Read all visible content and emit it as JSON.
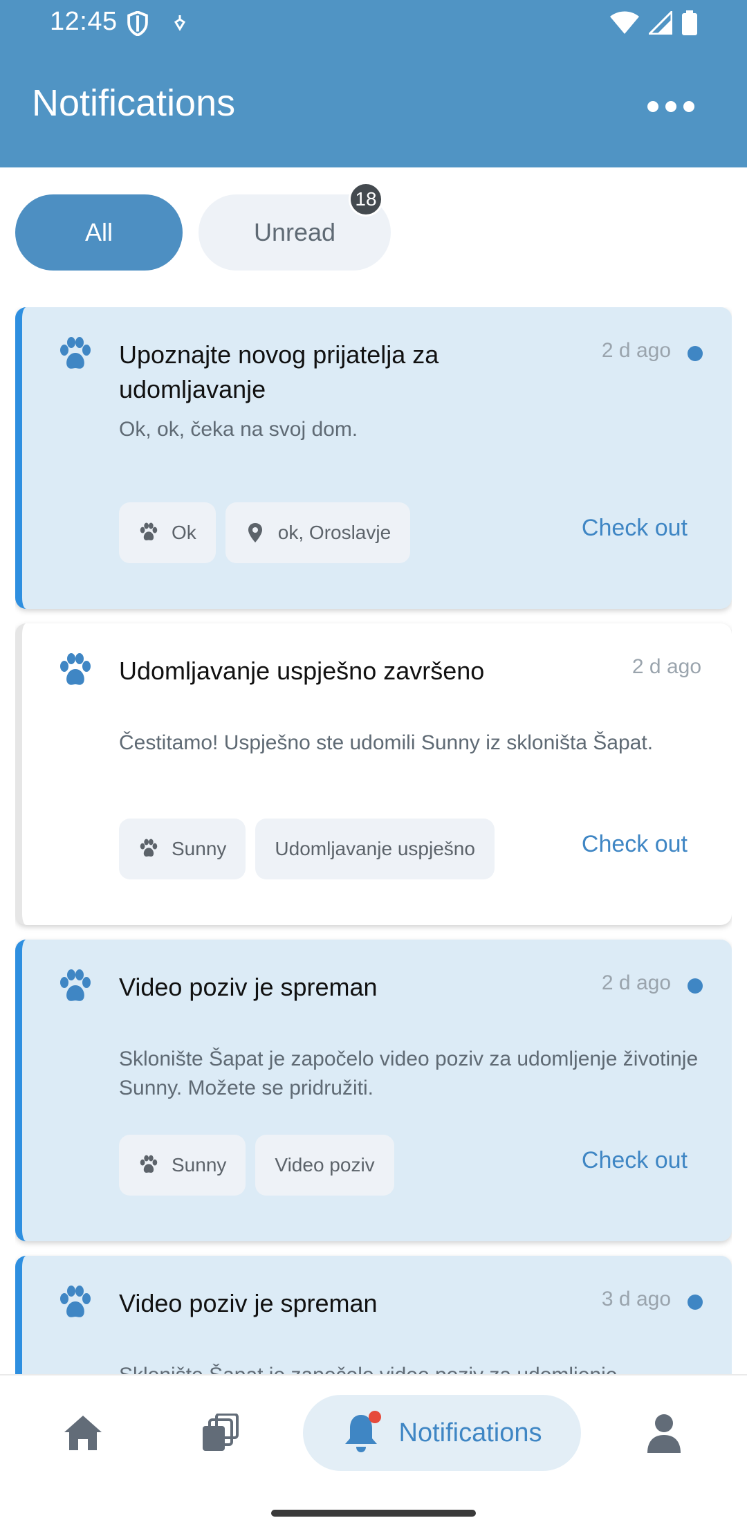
{
  "status_bar": {
    "time": "12:45"
  },
  "header": {
    "title": "Notifications",
    "more_icon": "more-horizontal-icon"
  },
  "filters": {
    "all_label": "All",
    "unread_label": "Unread",
    "unread_count": "18",
    "active": "All"
  },
  "notifications": [
    {
      "title": "Upoznajte novog prijatelja za udomljavanje",
      "time": "2 d ago",
      "unread": true,
      "body": "Ok, ok,  čeka na svoj dom.",
      "chips": [
        {
          "icon": "paw-icon",
          "label": "Ok"
        },
        {
          "icon": "location-pin-icon",
          "label": "ok, Oroslavje"
        }
      ],
      "action": "Check out"
    },
    {
      "title": "Udomljavanje uspješno završeno",
      "time": "2 d ago",
      "unread": false,
      "body": "Čestitamo! Uspješno ste udomili Sunny iz skloništa Šapat.",
      "chips": [
        {
          "icon": "paw-icon",
          "label": "Sunny"
        },
        {
          "icon": "",
          "label": "Udomljavanje uspješno"
        }
      ],
      "action": "Check out"
    },
    {
      "title": "Video poziv je spreman",
      "time": "2 d ago",
      "unread": true,
      "body": "Sklonište Šapat je započelo video poziv za udomljenje životinje Sunny. Možete se pridružiti.",
      "chips": [
        {
          "icon": "paw-icon",
          "label": "Sunny"
        },
        {
          "icon": "",
          "label": "Video poziv"
        }
      ],
      "action": "Check out"
    },
    {
      "title": "Video poziv je spreman",
      "time": "3 d ago",
      "unread": true,
      "body": "Sklonište Šapat je započelo video poziv za udomljenje",
      "chips": [],
      "action": ""
    }
  ],
  "bottom_nav": {
    "home_icon": "home-icon",
    "cards_icon": "cards-icon",
    "notifications_label": "Notifications",
    "profile_icon": "profile-icon",
    "active": "Notifications"
  },
  "colors": {
    "header": "#5094c4",
    "accent": "#3f86c4",
    "unread_card": "#dcebf6",
    "unread_border": "#2e8fe0",
    "badge": "#444a4f",
    "red_dot": "#e64a3b"
  }
}
